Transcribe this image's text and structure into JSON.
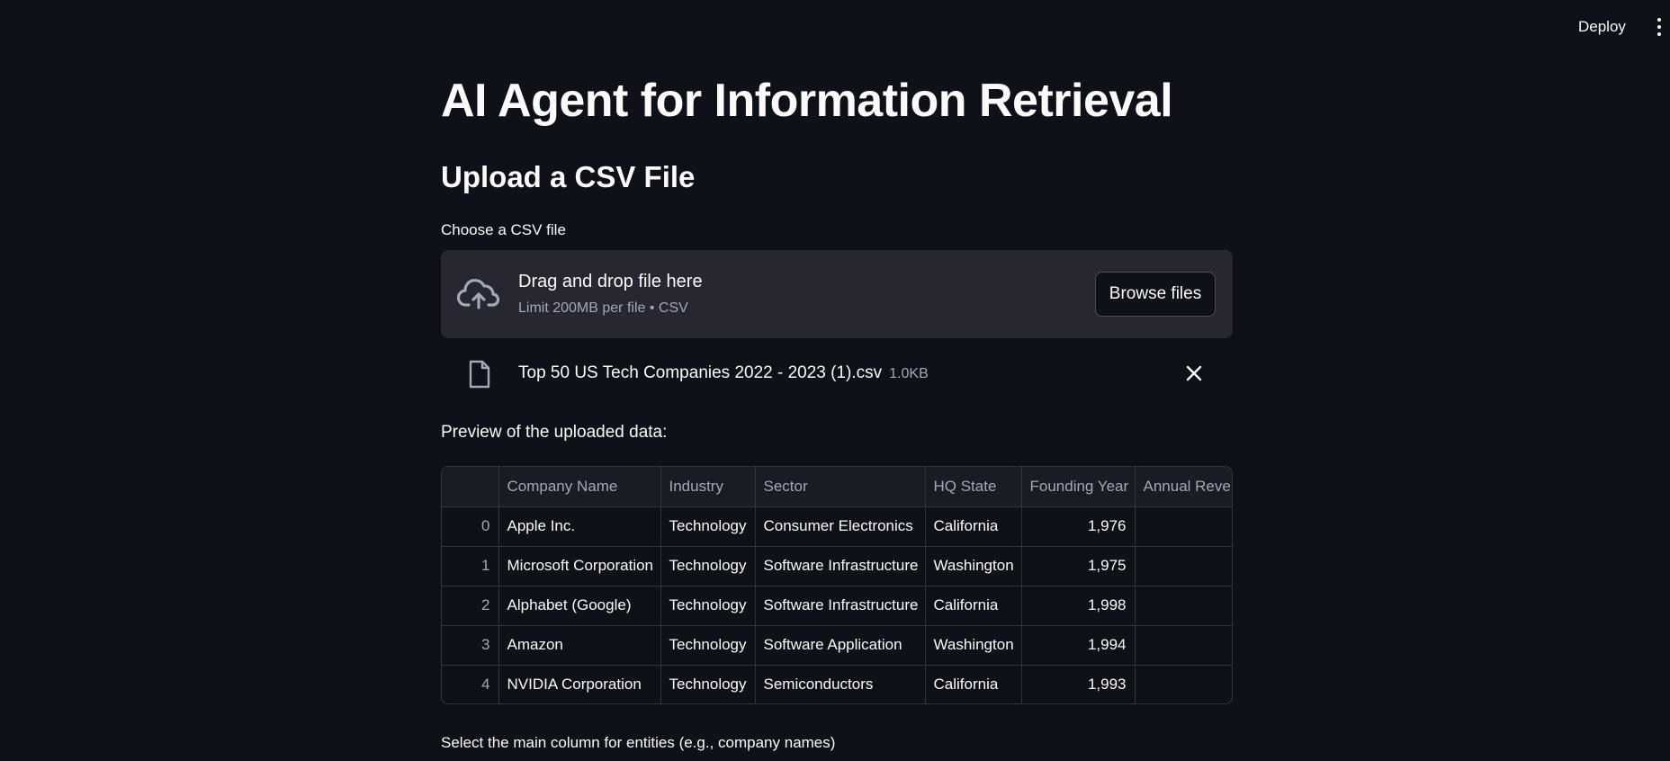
{
  "header": {
    "deploy_label": "Deploy",
    "menu_icon": "more-vert-icon"
  },
  "page": {
    "title": "AI Agent for Information Retrieval",
    "section_title": "Upload a CSV File"
  },
  "uploader": {
    "label": "Choose a CSV file",
    "drop_title": "Drag and drop file here",
    "drop_subtitle": "Limit 200MB per file • CSV",
    "browse_label": "Browse files",
    "icon": "cloud-upload-icon"
  },
  "uploaded_file": {
    "name": "Top 50 US Tech Companies 2022 - 2023 (1).csv",
    "size": "1.0KB",
    "icon": "file-icon",
    "remove_icon": "close-icon"
  },
  "preview": {
    "label": "Preview of the uploaded data:",
    "columns": [
      "",
      "Company Name",
      "Industry",
      "Sector",
      "HQ State",
      "Founding Year",
      "Annual Revenue"
    ],
    "rows": [
      [
        "0",
        "Apple Inc.",
        "Technology",
        "Consumer Electronics",
        "California",
        "1,976",
        ""
      ],
      [
        "1",
        "Microsoft Corporation",
        "Technology",
        "Software Infrastructure",
        "Washington",
        "1,975",
        ""
      ],
      [
        "2",
        "Alphabet (Google)",
        "Technology",
        "Software Infrastructure",
        "California",
        "1,998",
        ""
      ],
      [
        "3",
        "Amazon",
        "Technology",
        "Software Application",
        "Washington",
        "1,994",
        ""
      ],
      [
        "4",
        "NVIDIA Corporation",
        "Technology",
        "Semiconductors",
        "California",
        "1,993",
        ""
      ]
    ]
  },
  "entity_select": {
    "label": "Select the main column for entities (e.g., company names)"
  },
  "colors": {
    "background": "#0e1117",
    "surface": "#262730",
    "border": "#31333f",
    "muted_text": "#a3a8b8",
    "text": "#fafafa"
  }
}
